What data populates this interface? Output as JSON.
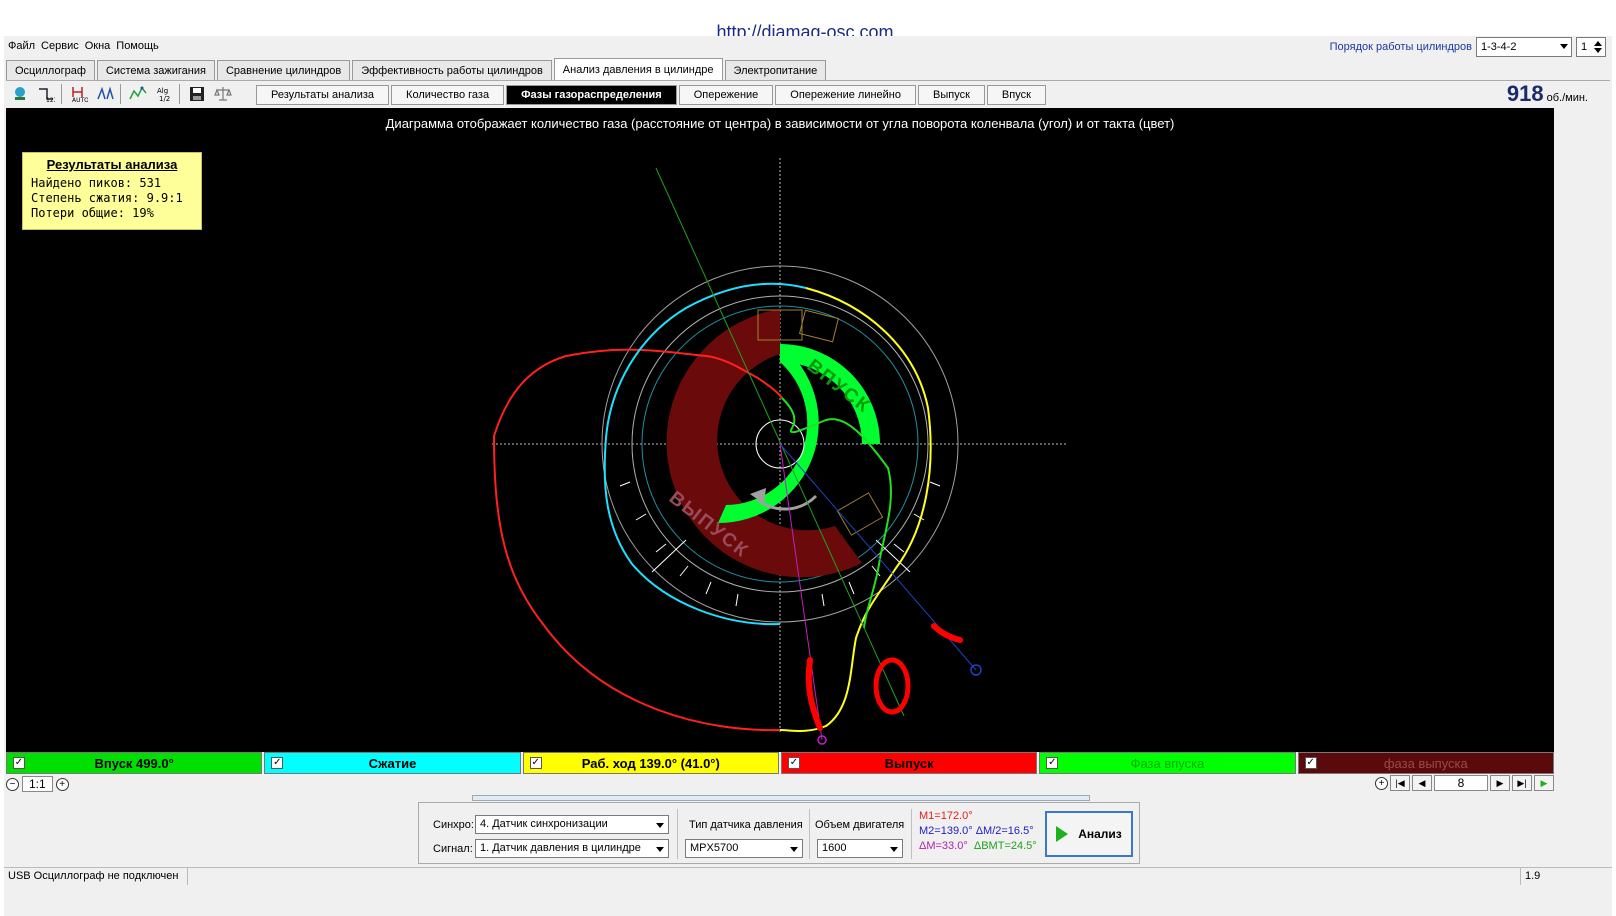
{
  "url_banner": "http://diamag-osc.com",
  "menu": [
    "Файл",
    "Сервис",
    "Окна",
    "Помощь"
  ],
  "cylinder_order": {
    "label": "Порядок работы цилиндров",
    "value": "1-3-4-2",
    "cylinder": "1"
  },
  "main_tabs": [
    "Осциллограф",
    "Система зажигания",
    "Сравнение цилиндров",
    "Эффективность работы цилиндров",
    "Анализ давления в цилиндре",
    "Электропитание"
  ],
  "active_main_tab": "Анализ давления в цилиндре",
  "toolbar_icons": [
    "scope-icon",
    "sync-icon",
    "auto-icon",
    "compare-icon",
    "wave-icon",
    "algorithm-icon",
    "save-icon",
    "balance-icon"
  ],
  "sub_tabs": [
    "Результаты анализа",
    "Количество газа",
    "Фазы газораспределения",
    "Опережение",
    "Опережение линейно",
    "Выпуск",
    "Впуск"
  ],
  "active_sub_tab": "Фазы газораспределения",
  "rpm": {
    "value": "918",
    "unit": "об./мин."
  },
  "caption": "Диаграмма отображает количество газа (расстояние от центра) в зависимости от угла поворота коленвала (угол) и от такта (цвет)",
  "results": {
    "title": "Результаты анализа",
    "lines": [
      "Найдено пиков: 531",
      "Степень сжатия: 9.9:1",
      "Потери общие: 19%"
    ]
  },
  "diagram_labels": {
    "intake": "ВПУСК",
    "exhaust": "ВЫПУСК"
  },
  "legend": [
    {
      "label": "Впуск 499.0°",
      "bg": "#00e000",
      "fg": "#000000"
    },
    {
      "label": "Сжатие",
      "bg": "#00ffff",
      "fg": "#000000"
    },
    {
      "label": "Раб. ход 139.0° (41.0°)",
      "bg": "#ffff00",
      "fg": "#000000"
    },
    {
      "label": "Выпуск",
      "bg": "#ff0000",
      "fg": "#000000"
    },
    {
      "label": "Фаза впуска",
      "bg": "#00ff00",
      "fg": "#00b000"
    },
    {
      "label": "фаза выпуска",
      "bg": "#5a0a0a",
      "fg": "#9a4a4a"
    }
  ],
  "zoom": "1:1",
  "frame": "8",
  "params": {
    "sync_label": "Синхро:",
    "sync_value": "4.  Датчик синхронизации",
    "signal_label": "Сигнал:",
    "signal_value": "1.  Датчик давления в цилиндре",
    "sensor_type_label": "Тип датчика давления",
    "sensor_type_value": "MPX5700",
    "volume_label": "Объем двигателя",
    "volume_value": "1600",
    "m1": "M1=172.0°",
    "m2": "M2=139.0°",
    "dm2": "ΔM/2=16.5°",
    "dm": "ΔM=33.0°",
    "dbmt": "ΔВМТ=24.5°",
    "analyze_label": "Анализ"
  },
  "status": {
    "left": "USB Осциллограф не подключен",
    "right": "1.9"
  }
}
